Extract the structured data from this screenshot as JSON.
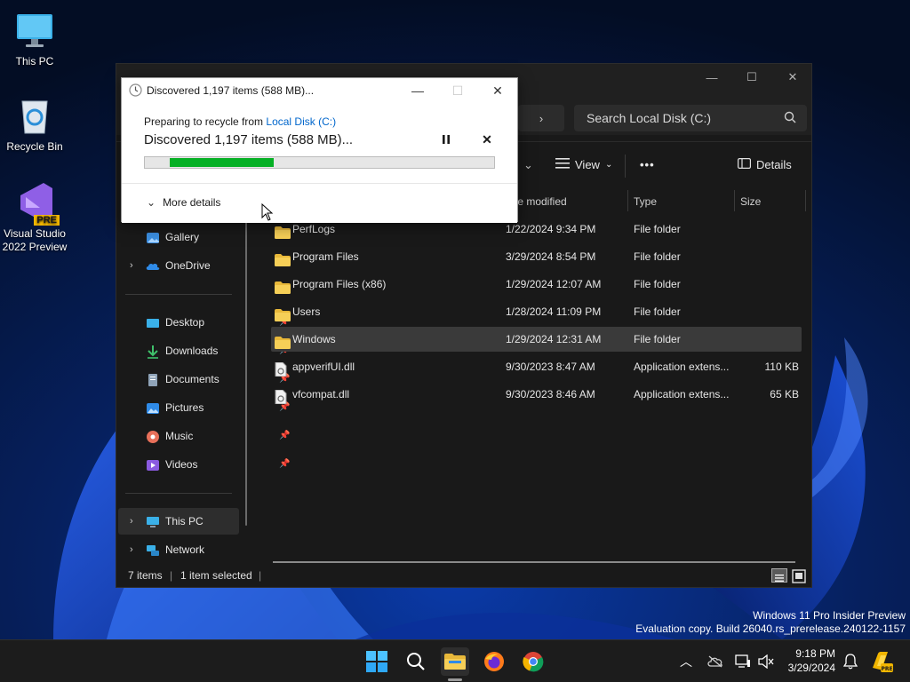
{
  "desktop": {
    "icons": [
      {
        "label": "This PC"
      },
      {
        "label": "Recycle Bin"
      },
      {
        "label": "Visual Studio 2022 Preview",
        "badge": "PRE"
      }
    ],
    "watermark": {
      "line1": "Windows 11 Pro Insider Preview",
      "line2": "Evaluation copy. Build 26040.rs_prerelease.240122-1157"
    }
  },
  "explorer": {
    "breadcrumb_chevron": "›",
    "search_placeholder": "Search Local Disk (C:)",
    "toolbar": {
      "view_label": "View",
      "more_label": "•••",
      "details_label": "Details"
    },
    "columns": {
      "date": "Date modified",
      "date_visible": "te modified",
      "type": "Type",
      "size": "Size"
    },
    "nav": {
      "gallery": "Gallery",
      "onedrive": "OneDrive",
      "quick_access": [
        {
          "label": "Desktop"
        },
        {
          "label": "Downloads"
        },
        {
          "label": "Documents"
        },
        {
          "label": "Pictures"
        },
        {
          "label": "Music"
        },
        {
          "label": "Videos"
        }
      ],
      "this_pc": "This PC",
      "network": "Network"
    },
    "files": [
      {
        "name": "PerfLogs",
        "date": "1/22/2024 9:34 PM",
        "type": "File folder",
        "size": "",
        "kind": "folder"
      },
      {
        "name": "Program Files",
        "date": "3/29/2024 8:54 PM",
        "type": "File folder",
        "size": "",
        "kind": "folder"
      },
      {
        "name": "Program Files (x86)",
        "date": "1/29/2024 12:07 AM",
        "type": "File folder",
        "size": "",
        "kind": "folder"
      },
      {
        "name": "Users",
        "date": "1/28/2024 11:09 PM",
        "type": "File folder",
        "size": "",
        "kind": "folder"
      },
      {
        "name": "Windows",
        "date": "1/29/2024 12:31 AM",
        "type": "File folder",
        "size": "",
        "kind": "folder",
        "selected": true
      },
      {
        "name": "appverifUI.dll",
        "date": "9/30/2023 8:47 AM",
        "type": "Application extens...",
        "size": "110 KB",
        "kind": "dll"
      },
      {
        "name": "vfcompat.dll",
        "date": "9/30/2023 8:46 AM",
        "type": "Application extens...",
        "size": "65 KB",
        "kind": "dll"
      }
    ],
    "status": {
      "items": "7 items",
      "selected": "1 item selected"
    }
  },
  "dialog": {
    "title": "Discovered 1,197 items (588 MB)...",
    "preparing_prefix": "Preparing to recycle from ",
    "preparing_link": "Local Disk (C:)",
    "headline": "Discovered 1,197 items (588 MB)...",
    "progress_percent": 32,
    "more_details": "More details"
  },
  "taskbar": {
    "time": "9:18 PM",
    "date": "3/29/2024"
  },
  "colors": {
    "progress_green": "#06b025",
    "link_blue": "#0066cc",
    "selection": "#3a3a3a"
  }
}
